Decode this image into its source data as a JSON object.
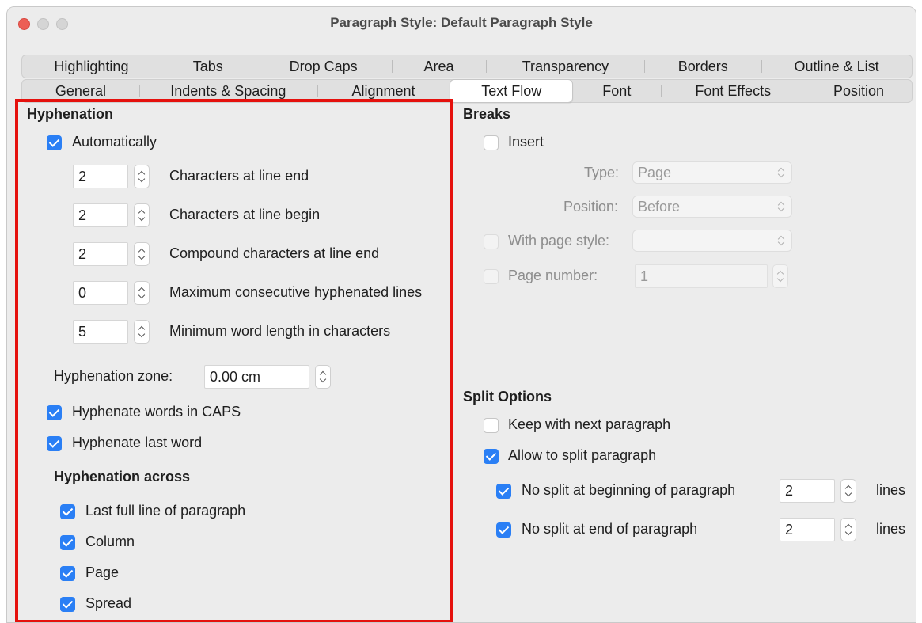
{
  "window": {
    "title": "Paragraph Style: Default Paragraph Style"
  },
  "tabs": {
    "row1": [
      "Highlighting",
      "Tabs",
      "Drop Caps",
      "Area",
      "Transparency",
      "Borders",
      "Outline & List"
    ],
    "row2": [
      "General",
      "Indents & Spacing",
      "Alignment",
      "Text Flow",
      "Font",
      "Font Effects",
      "Position"
    ],
    "active": "Text Flow"
  },
  "hyphenation": {
    "heading": "Hyphenation",
    "automatically": {
      "label": "Automatically",
      "checked": true
    },
    "chars_line_end": {
      "value": "2",
      "label": "Characters at line end"
    },
    "chars_line_begin": {
      "value": "2",
      "label": "Characters at line begin"
    },
    "compound_chars": {
      "value": "2",
      "label": "Compound characters at line end"
    },
    "max_consecutive": {
      "value": "0",
      "label": "Maximum consecutive hyphenated lines"
    },
    "min_word_length": {
      "value": "5",
      "label": "Minimum word length in characters"
    },
    "zone": {
      "label": "Hyphenation zone:",
      "value": "0.00 cm"
    },
    "caps": {
      "label": "Hyphenate words in CAPS",
      "checked": true
    },
    "last_word": {
      "label": "Hyphenate last word",
      "checked": true
    },
    "across": {
      "heading": "Hyphenation across",
      "last_full_line": {
        "label": "Last full line of paragraph",
        "checked": true
      },
      "column": {
        "label": "Column",
        "checked": true
      },
      "page": {
        "label": "Page",
        "checked": true
      },
      "spread": {
        "label": "Spread",
        "checked": true
      }
    }
  },
  "breaks": {
    "heading": "Breaks",
    "insert": {
      "label": "Insert",
      "checked": false
    },
    "type": {
      "label": "Type:",
      "value": "Page"
    },
    "position": {
      "label": "Position:",
      "value": "Before"
    },
    "page_style": {
      "label": "With page style:",
      "value": ""
    },
    "page_number": {
      "label": "Page number:",
      "value": "1"
    }
  },
  "split": {
    "heading": "Split Options",
    "keep_next": {
      "label": "Keep with next paragraph",
      "checked": false
    },
    "allow_split": {
      "label": "Allow to split paragraph",
      "checked": true
    },
    "no_split_begin": {
      "label": "No split at beginning of paragraph",
      "value": "2",
      "unit": "lines",
      "checked": true
    },
    "no_split_end": {
      "label": "No split at end of paragraph",
      "value": "2",
      "unit": "lines",
      "checked": true
    }
  },
  "colors": {
    "accent": "#2a7ff5",
    "highlight_border": "#e5110d"
  }
}
